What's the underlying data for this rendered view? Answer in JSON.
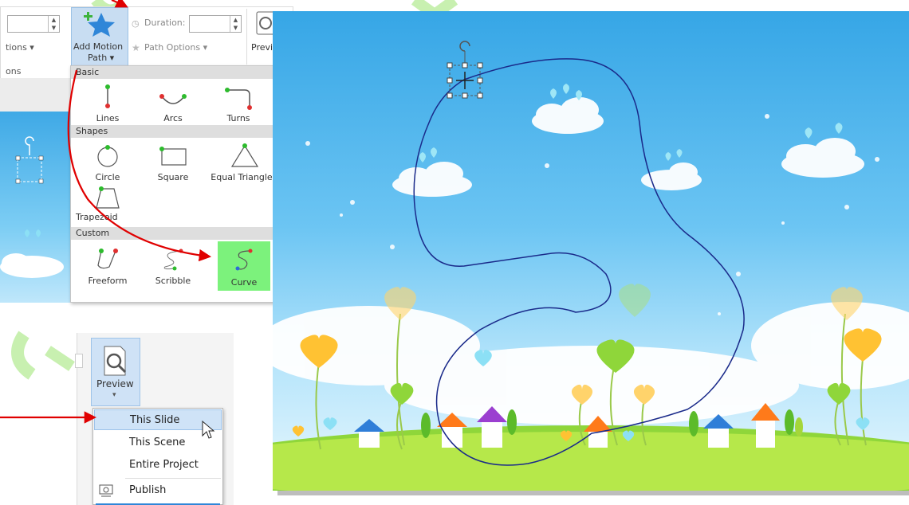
{
  "ribbon": {
    "options_left": "tions ▾",
    "options_left2": "ons",
    "add_motion_label": "Add Motion",
    "add_motion_sub": "Path ▾",
    "duration_label": "Duration:",
    "path_options_label": "Path Options ▾",
    "preview_cut": "Previ"
  },
  "motion_paths": {
    "basic_header": "Basic",
    "shapes_header": "Shapes",
    "custom_header": "Custom",
    "basic": [
      "Lines",
      "Arcs",
      "Turns"
    ],
    "shapes": [
      "Circle",
      "Square",
      "Equal Triangle",
      "Trapezoid"
    ],
    "custom": [
      "Freeform",
      "Scribble",
      "Curve"
    ]
  },
  "preview": {
    "label": "Preview",
    "menu": [
      "This Slide",
      "This Scene",
      "Entire Project",
      "Publish"
    ]
  },
  "colors": {
    "highlight_curve": "#7cf27c",
    "arrow": "#e00000",
    "path_line": "#1a2a8a",
    "selected_menu": "#cfe3f7"
  }
}
